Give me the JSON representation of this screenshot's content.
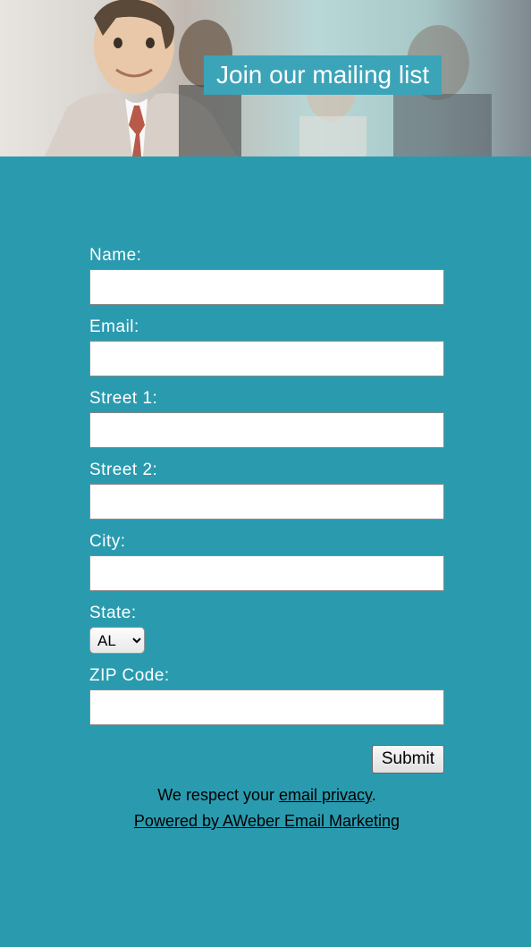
{
  "banner": {
    "title": "Join our mailing list"
  },
  "form": {
    "name_label": "Name:",
    "name_value": "",
    "email_label": "Email:",
    "email_value": "",
    "street1_label": "Street 1:",
    "street1_value": "",
    "street2_label": "Street 2:",
    "street2_value": "",
    "city_label": "City:",
    "city_value": "",
    "state_label": "State:",
    "state_value": "AL",
    "zip_label": "ZIP Code:",
    "zip_value": "",
    "submit_label": "Submit"
  },
  "footer": {
    "privacy_prefix": "We respect your ",
    "privacy_link": "email privacy",
    "privacy_suffix": ".",
    "powered_text": "Powered by AWeber Email Marketing"
  }
}
